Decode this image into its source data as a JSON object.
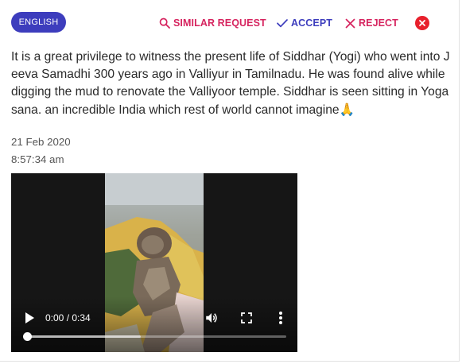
{
  "language_chip": "ENGLISH",
  "actions": {
    "similar_label": "SIMILAR REQUEST",
    "accept_label": "ACCEPT",
    "reject_label": "REJECT"
  },
  "message": {
    "text": "It is a great privilege to witness the present life of Siddhar (Yogi) who went into Jeeva Samadhi 300 years ago in Valliyur in Tamilnadu. He was found alive while digging the mud to renovate the Valliyoor temple. Siddhar is seen sitting in Yogasana. an incredible India which rest of world cannot imagine🙏",
    "date": "21 Feb 2020",
    "time": "8:57:34 am"
  },
  "video": {
    "time_display": "0:00 / 0:34",
    "progress_fraction": 0,
    "buffered_fraction": 0.44
  },
  "colors": {
    "chip": "#3d3dbd",
    "accent_pink": "#d6245f",
    "accent_indigo": "#3d3dbd",
    "close_red": "#e8202c"
  },
  "icons": {
    "similar": "search-icon",
    "accept": "check-icon",
    "reject": "close-icon",
    "dismiss": "close-circle-icon",
    "play": "play-icon",
    "volume": "volume-icon",
    "fullscreen": "fullscreen-icon",
    "more": "more-vert-icon"
  }
}
